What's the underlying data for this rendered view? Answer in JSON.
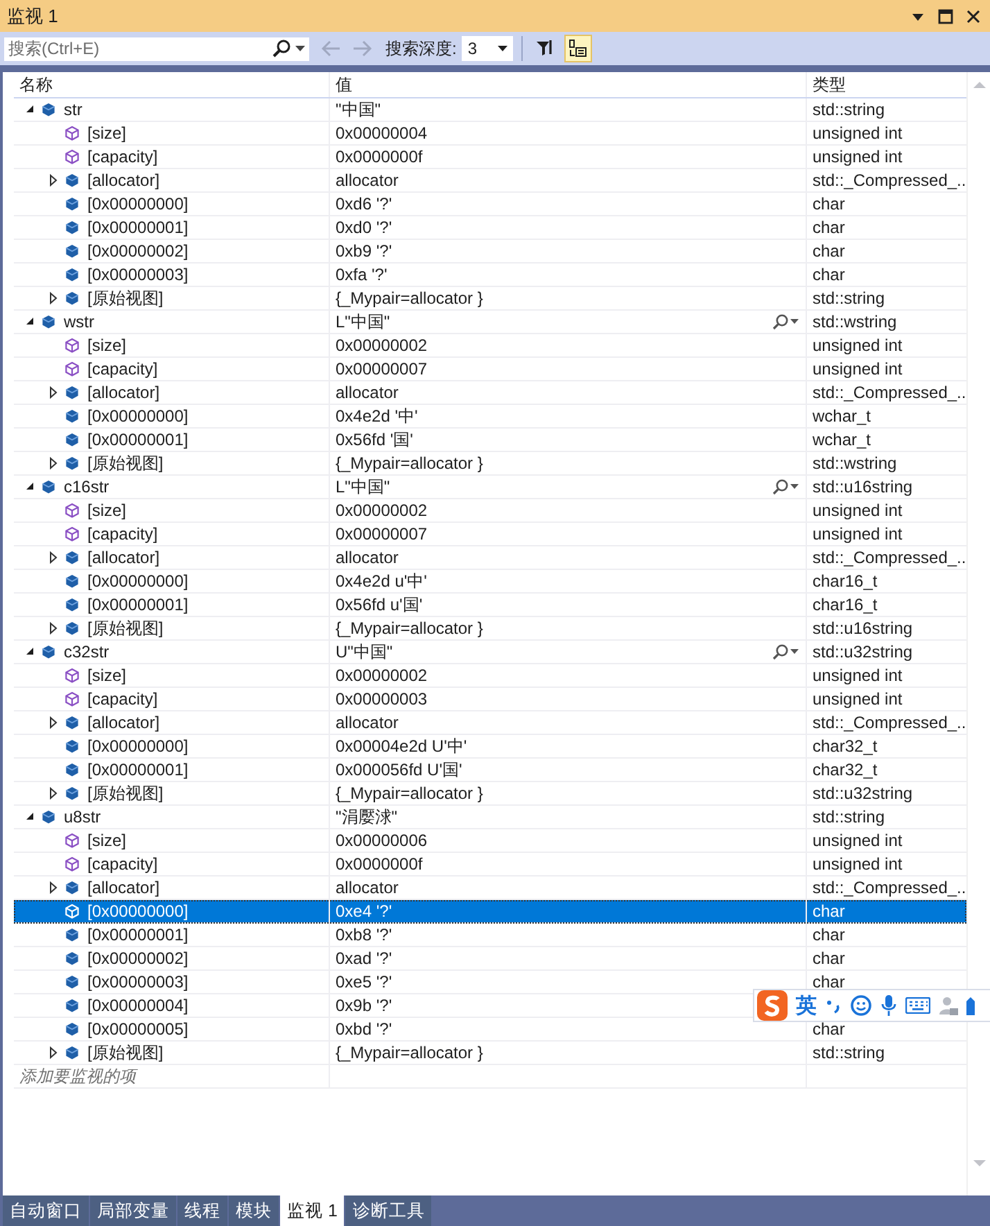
{
  "window": {
    "title": "监视 1"
  },
  "toolbar": {
    "search": {
      "placeholder": "搜索(Ctrl+E)"
    },
    "back_disabled": true,
    "forward_disabled": true,
    "depth_label": "搜索深度:",
    "depth": "3",
    "buttons": [
      {
        "kind": "filter",
        "selected": false
      },
      {
        "kind": "hex",
        "selected": true
      }
    ]
  },
  "table": {
    "columns": [
      "名称",
      "值",
      "类型"
    ],
    "rows": [
      {
        "name": "str",
        "value": "\"中国\"",
        "type": "std::string",
        "kind": "object",
        "selected": false,
        "expanded": true,
        "children": [
          {
            "name": "[size]",
            "value": "0x00000004",
            "type": "unsigned int",
            "kind": "property",
            "selected": false
          },
          {
            "name": "[capacity]",
            "value": "0x0000000f",
            "type": "unsigned int",
            "kind": "property",
            "selected": false
          },
          {
            "name": "[allocator]",
            "value": "allocator",
            "type": "std::_Compressed_...",
            "kind": "object",
            "selected": false,
            "expanded": false
          },
          {
            "name": "[0x00000000]",
            "value": "0xd6 '?'",
            "type": "char",
            "kind": "object",
            "selected": false
          },
          {
            "name": "[0x00000001]",
            "value": "0xd0 '?'",
            "type": "char",
            "kind": "object",
            "selected": false
          },
          {
            "name": "[0x00000002]",
            "value": "0xb9 '?'",
            "type": "char",
            "kind": "object",
            "selected": false
          },
          {
            "name": "[0x00000003]",
            "value": "0xfa '?'",
            "type": "char",
            "kind": "object",
            "selected": false
          },
          {
            "name": "[原始视图]",
            "value": "{_Mypair=allocator }",
            "type": "std::string",
            "kind": "object",
            "selected": false,
            "expanded": false
          }
        ]
      },
      {
        "name": "wstr",
        "value": "L\"中国\"",
        "type": "std::wstring",
        "kind": "object",
        "selected": false,
        "expanded": true,
        "visualizer": true,
        "children": [
          {
            "name": "[size]",
            "value": "0x00000002",
            "type": "unsigned int",
            "kind": "property",
            "selected": false
          },
          {
            "name": "[capacity]",
            "value": "0x00000007",
            "type": "unsigned int",
            "kind": "property",
            "selected": false
          },
          {
            "name": "[allocator]",
            "value": "allocator",
            "type": "std::_Compressed_...",
            "kind": "object",
            "selected": false,
            "expanded": false
          },
          {
            "name": "[0x00000000]",
            "value": "0x4e2d '中'",
            "type": "wchar_t",
            "kind": "object",
            "selected": false
          },
          {
            "name": "[0x00000001]",
            "value": "0x56fd '国'",
            "type": "wchar_t",
            "kind": "object",
            "selected": false
          },
          {
            "name": "[原始视图]",
            "value": "{_Mypair=allocator }",
            "type": "std::wstring",
            "kind": "object",
            "selected": false,
            "expanded": false
          }
        ]
      },
      {
        "name": "c16str",
        "value": "L\"中国\"",
        "type": "std::u16string",
        "kind": "object",
        "selected": false,
        "expanded": true,
        "visualizer": true,
        "children": [
          {
            "name": "[size]",
            "value": "0x00000002",
            "type": "unsigned int",
            "kind": "property",
            "selected": false
          },
          {
            "name": "[capacity]",
            "value": "0x00000007",
            "type": "unsigned int",
            "kind": "property",
            "selected": false
          },
          {
            "name": "[allocator]",
            "value": "allocator",
            "type": "std::_Compressed_...",
            "kind": "object",
            "selected": false,
            "expanded": false
          },
          {
            "name": "[0x00000000]",
            "value": "0x4e2d u'中'",
            "type": "char16_t",
            "kind": "object",
            "selected": false
          },
          {
            "name": "[0x00000001]",
            "value": "0x56fd u'国'",
            "type": "char16_t",
            "kind": "object",
            "selected": false
          },
          {
            "name": "[原始视图]",
            "value": "{_Mypair=allocator }",
            "type": "std::u16string",
            "kind": "object",
            "selected": false,
            "expanded": false
          }
        ]
      },
      {
        "name": "c32str",
        "value": "U\"中国\"",
        "type": "std::u32string",
        "kind": "object",
        "selected": false,
        "expanded": true,
        "visualizer": true,
        "children": [
          {
            "name": "[size]",
            "value": "0x00000002",
            "type": "unsigned int",
            "kind": "property",
            "selected": false
          },
          {
            "name": "[capacity]",
            "value": "0x00000003",
            "type": "unsigned int",
            "kind": "property",
            "selected": false
          },
          {
            "name": "[allocator]",
            "value": "allocator",
            "type": "std::_Compressed_...",
            "kind": "object",
            "selected": false,
            "expanded": false
          },
          {
            "name": "[0x00000000]",
            "value": "0x00004e2d U'中'",
            "type": "char32_t",
            "kind": "object",
            "selected": false
          },
          {
            "name": "[0x00000001]",
            "value": "0x000056fd U'国'",
            "type": "char32_t",
            "kind": "object",
            "selected": false
          },
          {
            "name": "[原始视图]",
            "value": "{_Mypair=allocator }",
            "type": "std::u32string",
            "kind": "object",
            "selected": false,
            "expanded": false
          }
        ]
      },
      {
        "name": "u8str",
        "value": "\"涓嬮浗\"",
        "type": "std::string",
        "kind": "object",
        "selected": false,
        "expanded": true,
        "children": [
          {
            "name": "[size]",
            "value": "0x00000006",
            "type": "unsigned int",
            "kind": "property",
            "selected": false
          },
          {
            "name": "[capacity]",
            "value": "0x0000000f",
            "type": "unsigned int",
            "kind": "property",
            "selected": false
          },
          {
            "name": "[allocator]",
            "value": "allocator",
            "type": "std::_Compressed_...",
            "kind": "object",
            "selected": false,
            "expanded": false
          },
          {
            "name": "[0x00000000]",
            "value": "0xe4 '?'",
            "type": "char",
            "kind": "object",
            "selected": true
          },
          {
            "name": "[0x00000001]",
            "value": "0xb8 '?'",
            "type": "char",
            "kind": "object",
            "selected": false
          },
          {
            "name": "[0x00000002]",
            "value": "0xad '?'",
            "type": "char",
            "kind": "object",
            "selected": false
          },
          {
            "name": "[0x00000003]",
            "value": "0xe5 '?'",
            "type": "char",
            "kind": "object",
            "selected": false
          },
          {
            "name": "[0x00000004]",
            "value": "0x9b '?'",
            "kind": "object",
            "selected": false
          },
          {
            "name": "[0x00000005]",
            "value": "0xbd '?'",
            "type": "char",
            "kind": "object",
            "selected": false
          },
          {
            "name": "[原始视图]",
            "value": "{_Mypair=allocator }",
            "type": "std::string",
            "kind": "object",
            "selected": false,
            "expanded": false
          }
        ]
      }
    ],
    "add_placeholder": "添加要监视的项"
  },
  "bottom_tabs": [
    {
      "label": "自动窗口",
      "selected": false
    },
    {
      "label": "局部变量",
      "selected": false
    },
    {
      "label": "线程",
      "selected": false
    },
    {
      "label": "模块",
      "selected": false
    },
    {
      "label": "监视 1",
      "selected": true
    },
    {
      "label": "诊断工具",
      "selected": false
    }
  ],
  "ime_toolbar": {
    "mode": "英"
  }
}
